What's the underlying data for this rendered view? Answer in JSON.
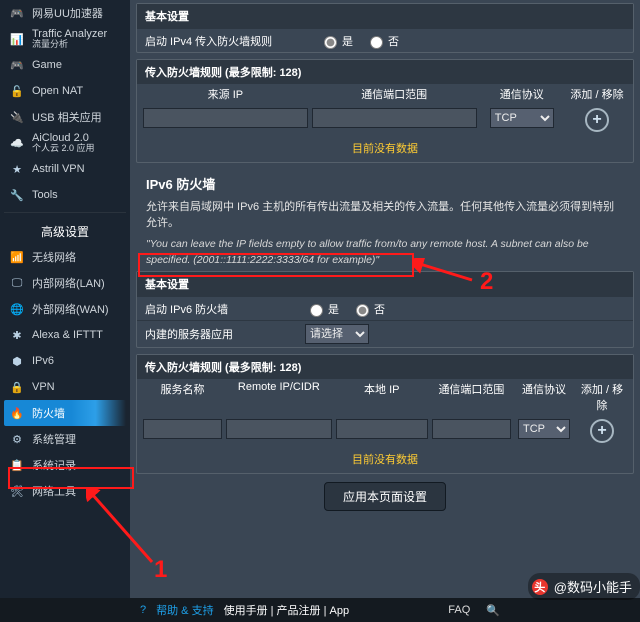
{
  "side": {
    "groupA": [
      {
        "label": "网易UU加速器"
      },
      {
        "label": "Traffic Analyzer",
        "sub": "流量分析"
      },
      {
        "label": "Game"
      },
      {
        "label": "Open NAT"
      },
      {
        "label": "USB 相关应用"
      },
      {
        "label": "AiCloud 2.0",
        "sub": "个人云 2.0 应用"
      },
      {
        "label": "Astrill VPN"
      },
      {
        "label": "Tools"
      }
    ],
    "advancedTitle": "高级设置",
    "groupB": [
      {
        "label": "无线网络"
      },
      {
        "label": "内部网络(LAN)"
      },
      {
        "label": "外部网络(WAN)"
      },
      {
        "label": "Alexa & IFTTT"
      },
      {
        "label": "IPv6"
      },
      {
        "label": "VPN"
      },
      {
        "label": "防火墙",
        "active": true
      },
      {
        "label": "系统管理"
      },
      {
        "label": "系统记录"
      },
      {
        "label": "网络工具"
      }
    ]
  },
  "ipv4": {
    "basicTitle": "基本设置",
    "enableLabel": "启动 IPv4 传入防火墙规则",
    "yes": "是",
    "no": "否",
    "rulesTitle": "传入防火墙规则 (最多限制: 128)",
    "cols": {
      "src": "来源 IP",
      "port": "通信端口范围",
      "proto": "通信协议",
      "add": "添加 / 移除"
    },
    "proto": "TCP",
    "nodata": "目前没有数据"
  },
  "ipv6": {
    "title": "IPv6 防火墙",
    "desc": "允许来自局域网中 IPv6 主机的所有传出流量及相关的传入流量。任何其他传入流量必须得到特别允许。",
    "note": "\"You can leave the IP fields empty to allow traffic from/to any remote host. A subnet can also be specified. (2001::1111:2222:3333/64 for example)\"",
    "basicTitle": "基本设置",
    "enableLabel": "启动 IPv6 防火墙",
    "yes": "是",
    "no": "否",
    "builtinLabel": "内建的服务器应用",
    "builtinSelect": "请选择",
    "rulesTitle": "传入防火墙规则 (最多限制: 128)",
    "cols": {
      "svc": "服务名称",
      "remote": "Remote IP/CIDR",
      "local": "本地 IP",
      "port": "通信端口范围",
      "proto": "通信协议",
      "add": "添加 / 移除"
    },
    "proto": "TCP",
    "nodata": "目前没有数据",
    "apply": "应用本页面设置"
  },
  "footer": {
    "help": "帮助 & 支持",
    "links": "使用手册 | 产品注册 | App",
    "faq": "FAQ"
  },
  "watermark": "@数码小能手",
  "anno": {
    "n1": "1",
    "n2": "2"
  }
}
